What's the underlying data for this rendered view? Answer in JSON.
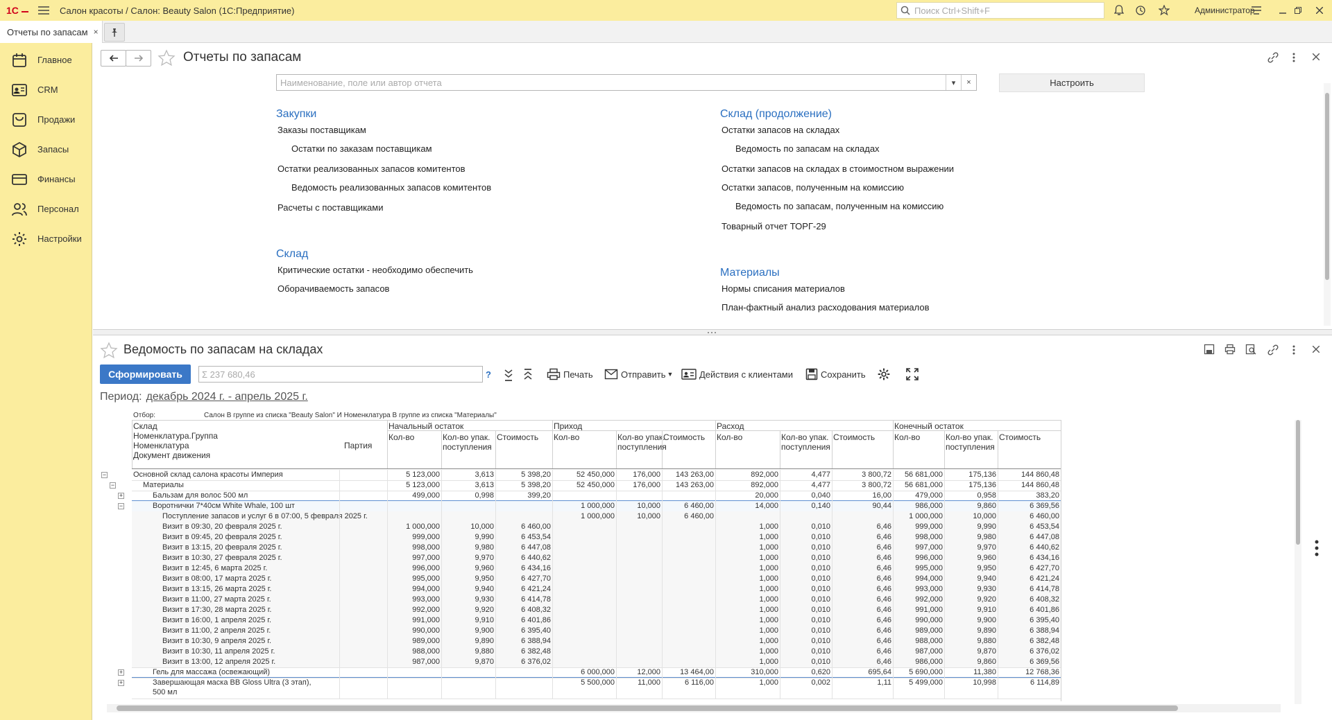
{
  "app": {
    "title": "Салон красоты / Салон: Beauty Salon  (1С:Предприятие)",
    "search_placeholder": "Поиск Ctrl+Shift+F",
    "user": "Администратор"
  },
  "tab": {
    "label": "Отчеты по запасам",
    "close": "×"
  },
  "sidebar": {
    "items": [
      {
        "label": "Главное",
        "icon": "calendar-icon"
      },
      {
        "label": "CRM",
        "icon": "contact-card-icon"
      },
      {
        "label": "Продажи",
        "icon": "shopping-bag-icon"
      },
      {
        "label": "Запасы",
        "icon": "box-icon"
      },
      {
        "label": "Финансы",
        "icon": "wallet-icon"
      },
      {
        "label": "Персонал",
        "icon": "people-icon"
      },
      {
        "label": "Настройки",
        "icon": "gear-icon"
      }
    ]
  },
  "reports": {
    "title": "Отчеты по запасам",
    "search_placeholder": "Наименование, поле или автор отчета",
    "settings_btn": "Настроить",
    "sections": [
      {
        "title": "Закупки",
        "items": [
          {
            "label": "Заказы поставщикам",
            "indent": 0
          },
          {
            "label": "Остатки по заказам поставщикам",
            "indent": 1
          },
          {
            "label": "Остатки реализованных запасов комитентов",
            "indent": 0
          },
          {
            "label": "Ведомость реализованных запасов комитентов",
            "indent": 1
          },
          {
            "label": "Расчеты с поставщиками",
            "indent": 0
          }
        ]
      },
      {
        "title": "Склад",
        "items": [
          {
            "label": "Критические остатки - необходимо обеспечить",
            "indent": 0
          },
          {
            "label": "Оборачиваемость запасов",
            "indent": 0
          }
        ]
      },
      {
        "title": "Склад (продолжение)",
        "items": [
          {
            "label": "Остатки запасов на складах",
            "indent": 0
          },
          {
            "label": "Ведомость по запасам на складах",
            "indent": 1
          },
          {
            "label": "Остатки запасов на складах в стоимостном выражении",
            "indent": 0
          },
          {
            "label": "Остатки запасов, полученным на комиссию",
            "indent": 0
          },
          {
            "label": "Ведомость по запасам, полученным на комиссию",
            "indent": 1
          },
          {
            "label": "Товарный отчет ТОРГ-29",
            "indent": 0
          }
        ]
      },
      {
        "title": "Материалы",
        "items": [
          {
            "label": "Нормы списания материалов",
            "indent": 0
          },
          {
            "label": "План-фактный анализ расходования материалов",
            "indent": 0
          }
        ]
      }
    ]
  },
  "report": {
    "title": "Ведомость по запасам на складах",
    "generate_btn": "Сформировать",
    "sum_value": "Σ 237 680,46",
    "help": "?",
    "toolbar": {
      "print": "Печать",
      "send": "Отправить",
      "actions": "Действия с клиентами",
      "save": "Сохранить"
    },
    "period_label": "Период:",
    "period_value": "декабрь 2024 г. - апрель 2025 г.",
    "filter_label": "Отбор:",
    "filter_value": "Салон В группе из списка \"Beauty Salon\" И Номенклатура В группе из списка \"Материалы\"",
    "head": {
      "sklad": "Склад",
      "group": "Номенклатура.Группа",
      "nom": "Номенклатура",
      "party": "Партия",
      "doc": "Документ движения",
      "g1": "Начальный остаток",
      "g2": "Приход",
      "g3": "Расход",
      "g4": "Конечный остаток",
      "qty": "Кол-во",
      "pack1": "Кол-во упак.",
      "pack2": "поступления",
      "cost": "Стоимость"
    },
    "rows": [
      {
        "l": 0,
        "t": "Основной склад салона красоты Империя",
        "e": "minus",
        "v": [
          "5 123,000",
          "3,613",
          "5 398,20",
          "52 450,000",
          "176,000",
          "143 263,00",
          "892,000",
          "4,477",
          "3 800,72",
          "56 681,000",
          "175,136",
          "144 860,48"
        ]
      },
      {
        "l": 1,
        "t": "Материалы",
        "e": "minus",
        "v": [
          "5 123,000",
          "3,613",
          "5 398,20",
          "52 450,000",
          "176,000",
          "143 263,00",
          "892,000",
          "4,477",
          "3 800,72",
          "56 681,000",
          "175,136",
          "144 860,48"
        ]
      },
      {
        "l": 2,
        "t": "Бальзам для волос 500 мл",
        "e": "plus",
        "v": [
          "499,000",
          "0,998",
          "399,20",
          "",
          "",
          "",
          "20,000",
          "0,040",
          "16,00",
          "479,000",
          "0,958",
          "383,20"
        ]
      },
      {
        "l": 2,
        "t": "Воротнички 7*40см White Whale, 100 шт",
        "e": "minus",
        "v": [
          "",
          "",
          "",
          "1 000,000",
          "10,000",
          "6 460,00",
          "14,000",
          "0,140",
          "90,44",
          "986,000",
          "9,860",
          "6 369,56"
        ]
      },
      {
        "l": 3,
        "t": "Поступление запасов и услуг 6 в 07:00, 5 февраля 2025 г.",
        "e": "",
        "v": [
          "",
          "",
          "",
          "1 000,000",
          "10,000",
          "6 460,00",
          "",
          "",
          "",
          "1 000,000",
          "10,000",
          "6 460,00"
        ]
      },
      {
        "l": 3,
        "t": "Визит в 09:30, 20 февраля 2025 г.",
        "e": "",
        "v": [
          "1 000,000",
          "10,000",
          "6 460,00",
          "",
          "",
          "",
          "1,000",
          "0,010",
          "6,46",
          "999,000",
          "9,990",
          "6 453,54"
        ]
      },
      {
        "l": 3,
        "t": "Визит в 09:45, 20 февраля 2025 г.",
        "e": "",
        "v": [
          "999,000",
          "9,990",
          "6 453,54",
          "",
          "",
          "",
          "1,000",
          "0,010",
          "6,46",
          "998,000",
          "9,980",
          "6 447,08"
        ]
      },
      {
        "l": 3,
        "t": "Визит в 13:15, 20 февраля 2025 г.",
        "e": "",
        "v": [
          "998,000",
          "9,980",
          "6 447,08",
          "",
          "",
          "",
          "1,000",
          "0,010",
          "6,46",
          "997,000",
          "9,970",
          "6 440,62"
        ]
      },
      {
        "l": 3,
        "t": "Визит в 10:30, 27 февраля 2025 г.",
        "e": "",
        "v": [
          "997,000",
          "9,970",
          "6 440,62",
          "",
          "",
          "",
          "1,000",
          "0,010",
          "6,46",
          "996,000",
          "9,960",
          "6 434,16"
        ]
      },
      {
        "l": 3,
        "t": "Визит в 12:45, 6 марта 2025 г.",
        "e": "",
        "v": [
          "996,000",
          "9,960",
          "6 434,16",
          "",
          "",
          "",
          "1,000",
          "0,010",
          "6,46",
          "995,000",
          "9,950",
          "6 427,70"
        ]
      },
      {
        "l": 3,
        "t": "Визит в 08:00, 17 марта 2025 г.",
        "e": "",
        "v": [
          "995,000",
          "9,950",
          "6 427,70",
          "",
          "",
          "",
          "1,000",
          "0,010",
          "6,46",
          "994,000",
          "9,940",
          "6 421,24"
        ]
      },
      {
        "l": 3,
        "t": "Визит в 13:15, 26 марта 2025 г.",
        "e": "",
        "v": [
          "994,000",
          "9,940",
          "6 421,24",
          "",
          "",
          "",
          "1,000",
          "0,010",
          "6,46",
          "993,000",
          "9,930",
          "6 414,78"
        ]
      },
      {
        "l": 3,
        "t": "Визит в 11:00, 27 марта 2025 г.",
        "e": "",
        "v": [
          "993,000",
          "9,930",
          "6 414,78",
          "",
          "",
          "",
          "1,000",
          "0,010",
          "6,46",
          "992,000",
          "9,920",
          "6 408,32"
        ]
      },
      {
        "l": 3,
        "t": "Визит в 17:30, 28 марта 2025 г.",
        "e": "",
        "v": [
          "992,000",
          "9,920",
          "6 408,32",
          "",
          "",
          "",
          "1,000",
          "0,010",
          "6,46",
          "991,000",
          "9,910",
          "6 401,86"
        ]
      },
      {
        "l": 3,
        "t": "Визит в 16:00, 1 апреля 2025 г.",
        "e": "",
        "v": [
          "991,000",
          "9,910",
          "6 401,86",
          "",
          "",
          "",
          "1,000",
          "0,010",
          "6,46",
          "990,000",
          "9,900",
          "6 395,40"
        ]
      },
      {
        "l": 3,
        "t": "Визит в 11:00, 2 апреля 2025 г.",
        "e": "",
        "v": [
          "990,000",
          "9,900",
          "6 395,40",
          "",
          "",
          "",
          "1,000",
          "0,010",
          "6,46",
          "989,000",
          "9,890",
          "6 388,94"
        ]
      },
      {
        "l": 3,
        "t": "Визит в 10:30, 9 апреля 2025 г.",
        "e": "",
        "v": [
          "989,000",
          "9,890",
          "6 388,94",
          "",
          "",
          "",
          "1,000",
          "0,010",
          "6,46",
          "988,000",
          "9,880",
          "6 382,48"
        ]
      },
      {
        "l": 3,
        "t": "Визит в 10:30, 11 апреля 2025 г.",
        "e": "",
        "v": [
          "988,000",
          "9,880",
          "6 382,48",
          "",
          "",
          "",
          "1,000",
          "0,010",
          "6,46",
          "987,000",
          "9,870",
          "6 376,02"
        ]
      },
      {
        "l": 3,
        "t": "Визит в 13:00, 12 апреля 2025 г.",
        "e": "",
        "v": [
          "987,000",
          "9,870",
          "6 376,02",
          "",
          "",
          "",
          "1,000",
          "0,010",
          "6,46",
          "986,000",
          "9,860",
          "6 369,56"
        ]
      },
      {
        "l": 2,
        "t": "Гель для массажа (освежающий)",
        "e": "plus",
        "v": [
          "",
          "",
          "",
          "6 000,000",
          "12,000",
          "13 464,00",
          "310,000",
          "0,620",
          "695,64",
          "5 690,000",
          "11,380",
          "12 768,36"
        ]
      },
      {
        "l": 2,
        "t": "Завершающая маска BB Gloss Ultra (3 этап),",
        "t2": "500 мл",
        "e": "plus",
        "v": [
          "",
          "",
          "",
          "5 500,000",
          "11,000",
          "6 116,00",
          "1,000",
          "0,002",
          "1,11",
          "5 499,000",
          "10,998",
          "6 114,89"
        ]
      }
    ]
  }
}
